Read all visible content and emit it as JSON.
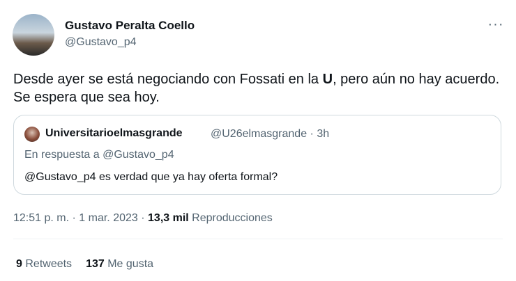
{
  "author": {
    "name": "Gustavo Peralta Coello",
    "handle": "@Gustavo_p4"
  },
  "more_icon": "···",
  "tweet": {
    "text_before": "Desde ayer se está negociando con Fossati en la ",
    "text_bold": "U",
    "text_after": ", pero aún no hay acuerdo. Se espera que sea hoy."
  },
  "quote": {
    "name": "Universitarioelmasgrande",
    "handle": "@U26elmasgrande",
    "separator": "·",
    "time": "3h",
    "reply_prefix": "En respuesta a ",
    "reply_to": "@Gustavo_p4",
    "text": "@Gustavo_p4 es verdad que ya hay oferta formal?"
  },
  "meta": {
    "time": "12:51 p. m.",
    "date": "1 mar. 2023",
    "separator": "·",
    "views": "13,3 mil",
    "views_label": "Reproducciones"
  },
  "stats": {
    "retweets_count": "9",
    "retweets_label": "Retweets",
    "likes_count": "137",
    "likes_label": "Me gusta"
  },
  "colors": {
    "text": "#0f1419",
    "secondary": "#536471",
    "border": "#cfd9de",
    "divider": "#eff3f4"
  }
}
